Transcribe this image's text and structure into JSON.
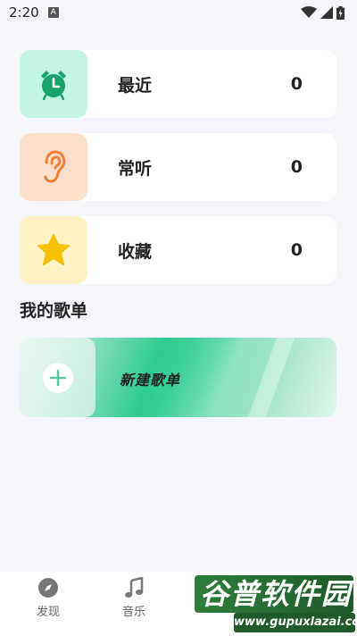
{
  "status_bar": {
    "time": "2:20",
    "notification_icon": "A"
  },
  "cards": [
    {
      "label": "最近",
      "count": "0",
      "icon": "alarm-clock-icon",
      "bg": "#c4f5e4",
      "icon_color": "#18a36d"
    },
    {
      "label": "常听",
      "count": "0",
      "icon": "ear-icon",
      "bg": "#fde0cb",
      "icon_color": "#ef7f35"
    },
    {
      "label": "收藏",
      "count": "0",
      "icon": "star-icon",
      "bg": "#fff3c6",
      "icon_color": "#f6c100"
    }
  ],
  "section_title": "我的歌单",
  "new_playlist": {
    "label": "新建歌单"
  },
  "nav": [
    {
      "label": "发现",
      "icon": "compass-icon"
    },
    {
      "label": "音乐",
      "icon": "music-note-icon"
    }
  ],
  "watermark": {
    "title": "谷普软件园",
    "url": "www.gupuxlazai.com"
  }
}
